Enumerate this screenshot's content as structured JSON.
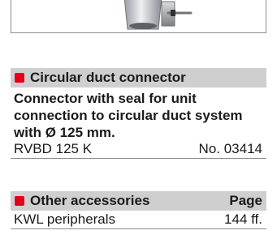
{
  "circular_section": {
    "title": "Circular duct connector",
    "description": "Connector with seal for unit connection to circular duct system with Ø 125 mm.",
    "product_name": "RVBD 125 K",
    "product_number": "No. 03414"
  },
  "accessories_section": {
    "title": "Other accessories",
    "page_header": "Page",
    "item_label": "KWL peripherals",
    "item_page": "144 ff."
  },
  "colors": {
    "accent": "#e2001a",
    "header_bg": "#cfcfcf",
    "rule": "#8c8c8c"
  }
}
